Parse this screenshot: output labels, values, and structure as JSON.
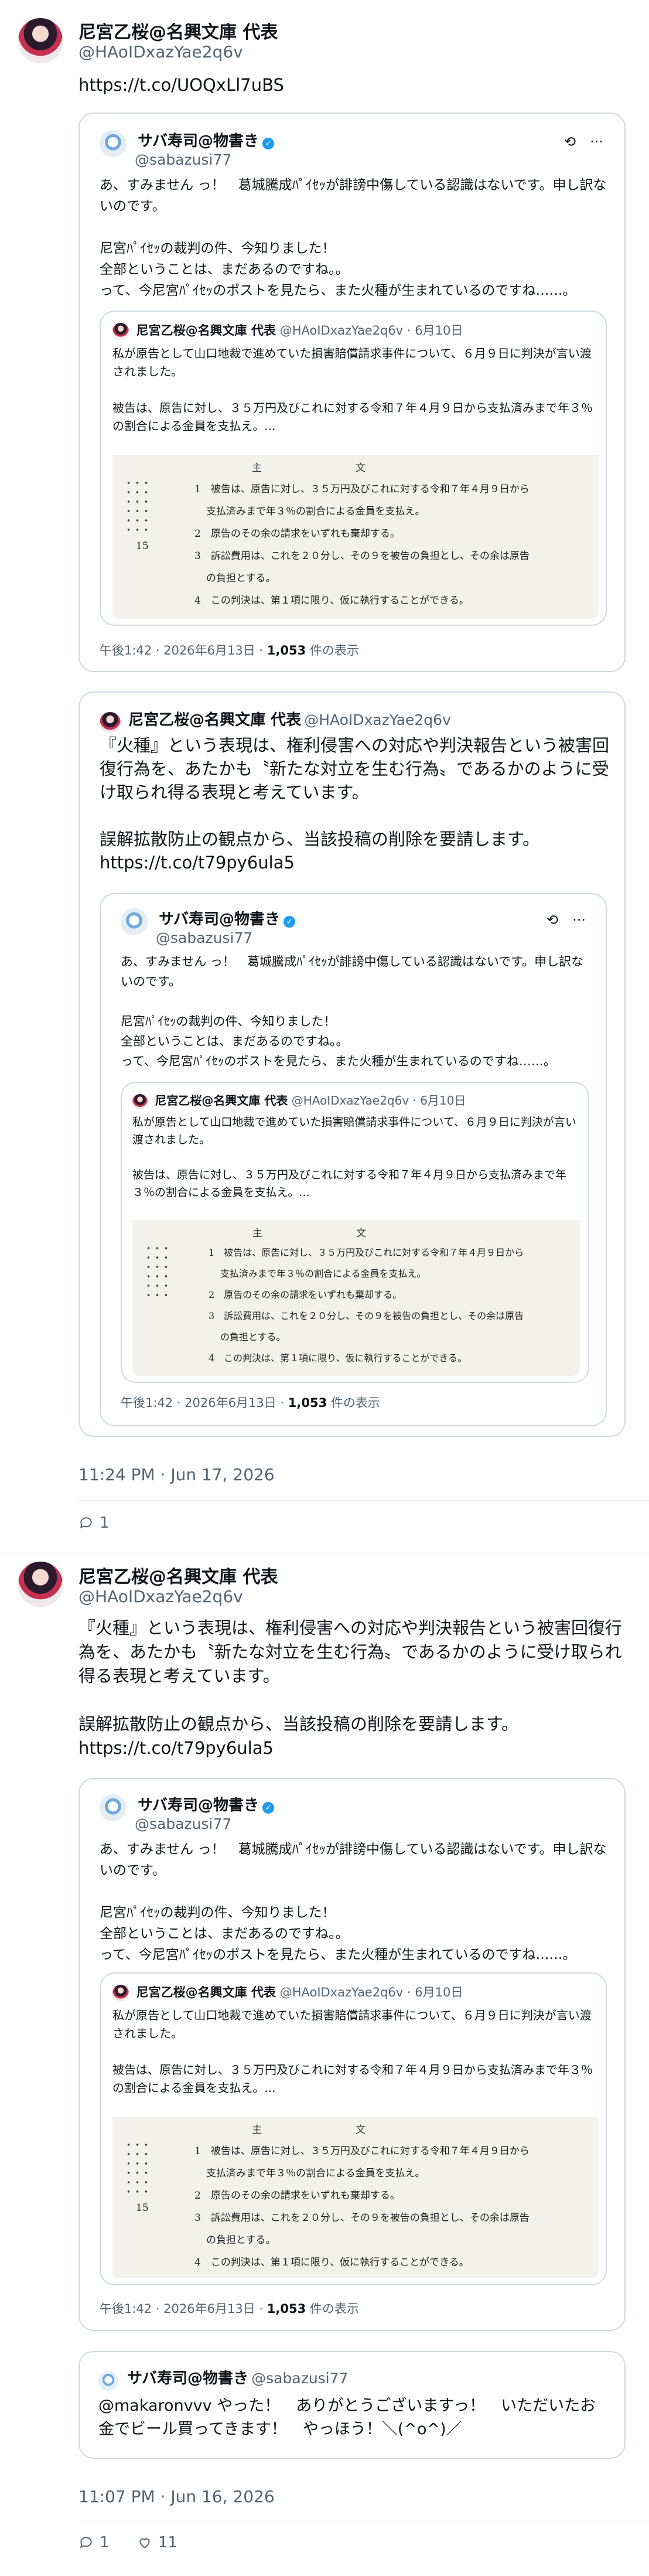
{
  "tweet1": {
    "name": "尼宮乙桜@名興文庫 代表",
    "handle": "@HAoIDxazYae2q6v",
    "text": "https://t.co/UOQxLl7uBS",
    "quote": {
      "name": "サバ寿司@物書き",
      "handle": "@sabazusi77",
      "text": "あ、すみません っ！　葛城騰成ﾊﾟｲｾｯが誹謗中傷している認識はないです。申し訳ないのです。\n\n尼宮ﾊﾟｲｾｯの裁判の件、今知りました！\n全部ということは、まだあるのですね。。\nって、今尼宮ﾊﾟｲｾｯのポストを見たら、また火種が生まれているのですね……。",
      "inner": {
        "name": "尼宮乙桜@名興文庫 代表",
        "handle": "@HAoIDxazYae2q6v",
        "date": "· 6月10日",
        "text": "私が原告として山口地裁で進めていた損害賠償請求事件について、６月９日に判決が言い渡されました。\n\n被告は、原告に対し、３５万円及びこれに対する令和７年４月９日から支払済みまで年３％の割合による金員を支払え。..."
      },
      "time": "午後1:42 · 2026年6月13日 · ",
      "views": "1,053",
      "views_suffix": " 件の表示"
    },
    "quote2": {
      "name": "尼宮乙桜@名興文庫 代表",
      "handle": "@HAoIDxazYae2q6v",
      "text": "『火種』という表現は、権利侵害への対応や判決報告という被害回復行為を、あたかも〝新たな対立を生む行為〟であるかのように受け取られ得る表現と考えています。\n\n誤解拡散防止の観点から、当該投稿の削除を要請します。\nhttps://t.co/t79py6ula5"
    },
    "timestamp": "11:24 PM · Jun 17, 2026",
    "replies": "1"
  },
  "tweet2": {
    "name": "尼宮乙桜@名興文庫 代表",
    "handle": "@HAoIDxazYae2q6v",
    "text": "『火種』という表現は、権利侵害への対応や判決報告という被害回復行為を、あたかも〝新たな対立を生む行為〟であるかのように受け取られ得る表現と考えています。\n\n誤解拡散防止の観点から、当該投稿の削除を要請します。\nhttps://t.co/t79py6ula5",
    "reply_card": {
      "name": "サバ寿司@物書き",
      "handle": "@sabazusi77",
      "text": "@makaronvvv やった！　ありがとうございますっ！　いただいたお金でビール買ってきます！　やっほう！＼(^o^)／"
    },
    "timestamp": "11:07 PM · Jun 16, 2026",
    "replies": "1",
    "likes": "11"
  },
  "doc": {
    "header": "主文",
    "lines": [
      "1　被告は、原告に対し、３５万円及びこれに対する令和７年４月９日から",
      "支払済みまで年３％の割合による金員を支払え。",
      "2　原告のその余の請求をいずれも棄却する。",
      "3　訴訟費用は、これを２０分し、その９を被告の負担とし、その余は原告",
      "の負担とする。",
      "4　この判決は、第１項に限り、仮に執行することができる。"
    ],
    "margin_num": "15"
  },
  "icons": {
    "verified": "verified-badge-icon",
    "grok": "grok-icon",
    "more": "more-icon",
    "reply": "reply-icon",
    "like": "like-icon"
  }
}
